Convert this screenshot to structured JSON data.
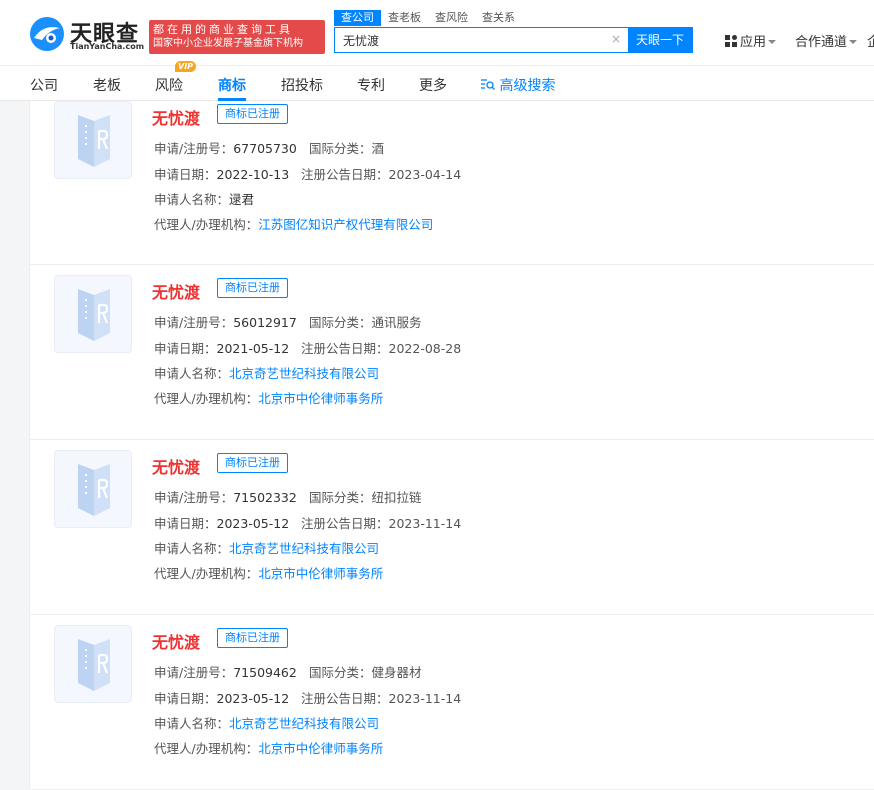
{
  "brand": {
    "name_cn": "天眼查",
    "name_en": "TianYanCha.com",
    "slogan_line1": "都在用的商业查询工具",
    "slogan_line2": "国家中小企业发展子基金旗下机构"
  },
  "search": {
    "tabs": [
      "查公司",
      "查老板",
      "查风险",
      "查关系"
    ],
    "value": "无忧渡",
    "clear": "×",
    "button": "天眼一下"
  },
  "header_right": {
    "apps": "应用",
    "partner": "合作通道",
    "more": "企"
  },
  "nav": {
    "items": [
      "公司",
      "老板",
      "风险",
      "商标",
      "招投标",
      "专利",
      "更多"
    ],
    "vip_badge": "VIP",
    "advanced_search": "高级搜索"
  },
  "labels": {
    "reg_no": "申请/注册号：",
    "intl_class": "国际分类：",
    "apply_date": "申请日期：",
    "announce_date": "注册公告日期：",
    "applicant": "申请人名称：",
    "agent": "代理人/办理机构："
  },
  "results": [
    {
      "name": "无忧渡",
      "status": "商标已注册",
      "reg_no": "67705730",
      "intl_class": "酒",
      "apply_date": "2022-10-13",
      "announce_date": "2023-04-14",
      "applicant": "逯君",
      "agent": "江苏图亿知识产权代理有限公司"
    },
    {
      "name": "无忧渡",
      "status": "商标已注册",
      "reg_no": "56012917",
      "intl_class": "通讯服务",
      "apply_date": "2021-05-12",
      "announce_date": "2022-08-28",
      "applicant": "北京奇艺世纪科技有限公司",
      "agent": "北京市中伦律师事务所"
    },
    {
      "name": "无忧渡",
      "status": "商标已注册",
      "reg_no": "71502332",
      "intl_class": "纽扣拉链",
      "apply_date": "2023-05-12",
      "announce_date": "2023-11-14",
      "applicant": "北京奇艺世纪科技有限公司",
      "agent": "北京市中伦律师事务所"
    },
    {
      "name": "无忧渡",
      "status": "商标已注册",
      "reg_no": "71509462",
      "intl_class": "健身器材",
      "apply_date": "2023-05-12",
      "announce_date": "2023-11-14",
      "applicant": "北京奇艺世纪科技有限公司",
      "agent": "北京市中伦律师事务所"
    }
  ]
}
